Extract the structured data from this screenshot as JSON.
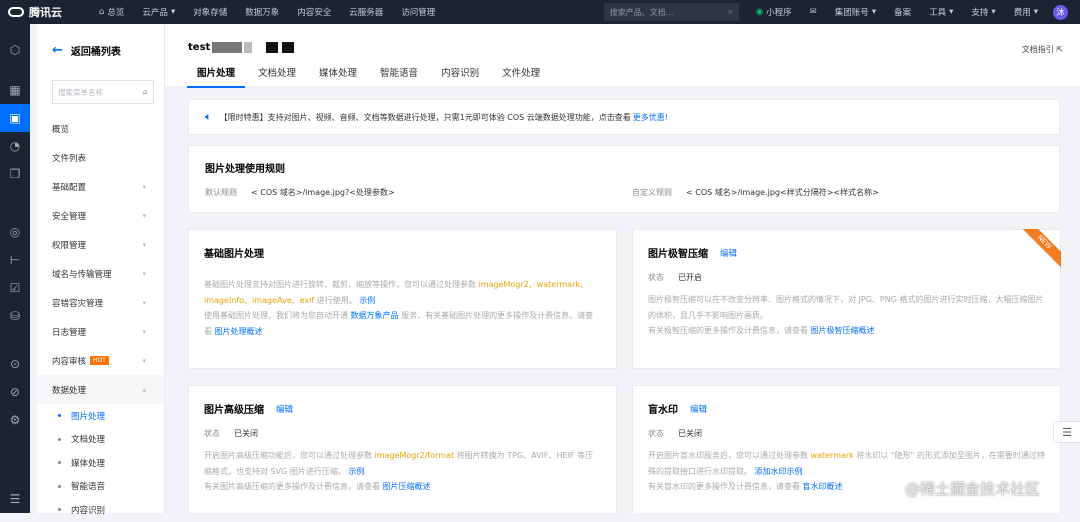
{
  "topbar": {
    "brand": "腾讯云",
    "overview": "总览",
    "nav": [
      "云产品",
      "对象存储",
      "数据万象",
      "内容安全",
      "云服务器",
      "访问管理"
    ],
    "search_placeholder": "搜索产品、文档...",
    "mini_program": "小程序",
    "account": "集团账号",
    "filing": "备案",
    "tools": "工具",
    "support": "支持",
    "billing": "费用",
    "avatar": "沐"
  },
  "sidebar": {
    "back": "返回桶列表",
    "search_placeholder": "搜索菜单名称",
    "items": [
      "概览",
      "文件列表",
      "基础配置",
      "安全管理",
      "权限管理",
      "域名与传输管理",
      "容错容灾管理",
      "日志管理",
      "内容审核",
      "数据处理"
    ],
    "hot": "HOT",
    "sub_items": [
      "图片处理",
      "文档处理",
      "媒体处理",
      "智能语音",
      "内容识别"
    ]
  },
  "header": {
    "bucket": "test",
    "doc_guide": "文档指引",
    "tabs": [
      "图片处理",
      "文档处理",
      "媒体处理",
      "智能语音",
      "内容识别",
      "文件处理"
    ]
  },
  "notice": {
    "text": "【限时特惠】支持对图片、视频、音频、文档等数据进行处理，只需1元即可体验 COS 云端数据处理功能，点击查看",
    "link": "更多优惠!"
  },
  "rules": {
    "title": "图片处理使用规则",
    "default_label": "默认规则",
    "default_value": "< COS 域名>/image.jpg?<处理参数>",
    "custom_label": "自定义规则",
    "custom_value": "< COS 域名>/image.jpg<样式分隔符><样式名称>"
  },
  "cards": {
    "basic": {
      "title": "基础图片处理",
      "d1": "基础图片处理支持对图片进行旋转、裁剪、缩放等操作，您可以通过处理参数",
      "p1": "imageMogr2、watermark、imageInfo、imageAve、exif",
      "d2": "进行使用。",
      "l1": "示例",
      "d3": "使用基础图片处理，我们将为您自动开通",
      "l2": "数据万象产品",
      "d4": "服务，有关基础图片处理的更多操作及计费信息，请查看",
      "l3": "图片处理概述"
    },
    "smart": {
      "title": "图片极智压缩",
      "edit": "编辑",
      "status_label": "状态",
      "status": "已开启",
      "new": "NEW",
      "d1": "图片极智压缩可以在不改变分辨率、图片格式的情况下，对 JPG、PNG 格式的图片进行实时压缩，大幅压缩图片的体积，且几乎不影响图片画质。",
      "d2": "有关极智压缩的更多操作及计费信息，请查看",
      "l1": "图片极智压缩概述"
    },
    "advanced": {
      "title": "图片高级压缩",
      "edit": "编辑",
      "status_label": "状态",
      "status": "已关闭",
      "d1": "开启图片高级压缩功能后，您可以通过处理参数",
      "p1": "imageMogr2/format",
      "d2": "将图片转换为 TPG、AVIF、HEIF 等压缩格式，也支持对 SVG 图片进行压缩。",
      "l1": "示例",
      "d3": "有关图片高级压缩的更多操作及计费信息，请查看",
      "l2": "图片压缩概述"
    },
    "blind": {
      "title": "盲水印",
      "edit": "编辑",
      "status_label": "状态",
      "status": "已关闭",
      "d1": "开启图片盲水印服务后，您可以通过处理参数",
      "p1": "watermark",
      "d2": "将水印以 \"隐形\" 的形式添加至图片，在需要时通过特殊的提取接口进行水印提取。",
      "l1": "添加水印示例",
      "d3": "有关盲水印的更多操作及计费信息，请查看",
      "l2": "盲水印概述"
    }
  },
  "watermark": "@稀土掘金技术社区"
}
